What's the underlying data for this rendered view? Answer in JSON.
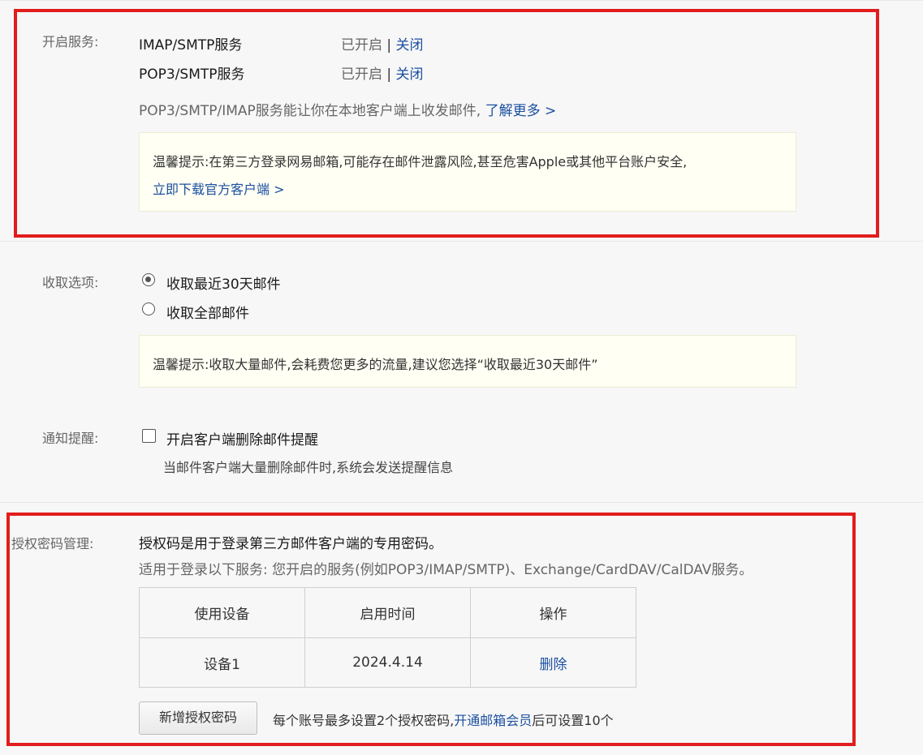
{
  "services": {
    "label": "开启服务:",
    "items": [
      {
        "name": "IMAP/SMTP服务",
        "status": "已开启",
        "separator": "|",
        "action": "关闭"
      },
      {
        "name": "POP3/SMTP服务",
        "status": "已开启",
        "separator": "|",
        "action": "关闭"
      }
    ],
    "description": "POP3/SMTP/IMAP服务能让你在本地客户端上收发邮件,",
    "learn_more": "了解更多 >",
    "tip_text": "温馨提示:在第三方登录网易邮箱,可能存在邮件泄露风险,甚至危害Apple或其他平台账户安全,",
    "tip_link": "立即下载官方客户端 >"
  },
  "fetch": {
    "label": "收取选项:",
    "options": [
      {
        "label": "收取最近30天邮件",
        "selected": true
      },
      {
        "label": "收取全部邮件",
        "selected": false
      }
    ],
    "tip_text": "温馨提示:收取大量邮件,会耗费您更多的流量,建议您选择“收取最近30天邮件”"
  },
  "notify": {
    "label": "通知提醒:",
    "checkbox_label": "开启客户端删除邮件提醒",
    "checked": false,
    "hint": "当邮件客户端大量删除邮件时,系统会发送提醒信息"
  },
  "auth": {
    "label": "授权密码管理:",
    "intro": "授权码是用于登录第三方邮件客户端的专用密码。",
    "subtitle": "适用于登录以下服务: 您开启的服务(例如POP3/IMAP/SMTP)、Exchange/CardDAV/CalDAV服务。",
    "table_headers": [
      "使用设备",
      "启用时间",
      "操作"
    ],
    "rows": [
      {
        "device": "设备1",
        "date": "2024.4.14",
        "action": "删除"
      }
    ],
    "add_button": "新增授权密码",
    "limit_prefix": "每个账号最多设置2个授权密码,",
    "limit_link": "开通邮箱会员",
    "limit_suffix": "后可设置10个"
  },
  "colors": {
    "link": "#1b4fa0",
    "highlight_box": "#e11d1d",
    "tip_background": "#fffff3"
  }
}
